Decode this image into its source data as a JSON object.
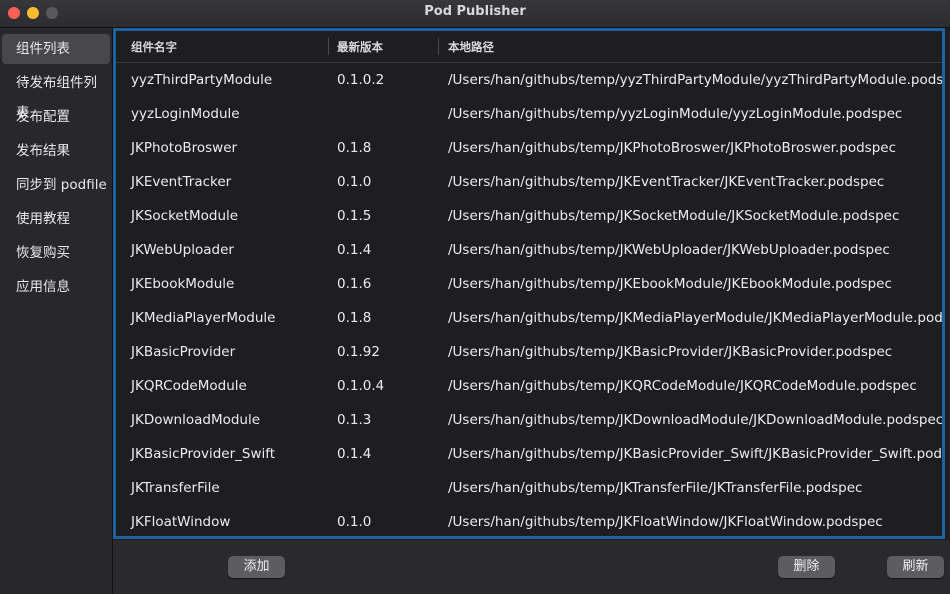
{
  "window": {
    "title": "Pod Publisher"
  },
  "sidebar": {
    "items": [
      {
        "label": "组件列表"
      },
      {
        "label": "待发布组件列表"
      },
      {
        "label": "发布配置"
      },
      {
        "label": "发布结果"
      },
      {
        "label": "同步到 podfile"
      },
      {
        "label": "使用教程"
      },
      {
        "label": "恢复购买"
      },
      {
        "label": "应用信息"
      }
    ]
  },
  "table": {
    "headers": {
      "name": "组件名字",
      "version": "最新版本",
      "path": "本地路径"
    },
    "rows": [
      {
        "name": "yyzThirdPartyModule",
        "version": "0.1.0.2",
        "path": "/Users/han/githubs/temp/yyzThirdPartyModule/yyzThirdPartyModule.podspec"
      },
      {
        "name": "yyzLoginModule",
        "version": "",
        "path": "/Users/han/githubs/temp/yyzLoginModule/yyzLoginModule.podspec"
      },
      {
        "name": "JKPhotoBroswer",
        "version": "0.1.8",
        "path": "/Users/han/githubs/temp/JKPhotoBroswer/JKPhotoBroswer.podspec"
      },
      {
        "name": "JKEventTracker",
        "version": "0.1.0",
        "path": "/Users/han/githubs/temp/JKEventTracker/JKEventTracker.podspec"
      },
      {
        "name": "JKSocketModule",
        "version": "0.1.5",
        "path": "/Users/han/githubs/temp/JKSocketModule/JKSocketModule.podspec"
      },
      {
        "name": "JKWebUploader",
        "version": "0.1.4",
        "path": "/Users/han/githubs/temp/JKWebUploader/JKWebUploader.podspec"
      },
      {
        "name": "JKEbookModule",
        "version": "0.1.6",
        "path": "/Users/han/githubs/temp/JKEbookModule/JKEbookModule.podspec"
      },
      {
        "name": "JKMediaPlayerModule",
        "version": "0.1.8",
        "path": "/Users/han/githubs/temp/JKMediaPlayerModule/JKMediaPlayerModule.podspec"
      },
      {
        "name": "JKBasicProvider",
        "version": "0.1.92",
        "path": "/Users/han/githubs/temp/JKBasicProvider/JKBasicProvider.podspec"
      },
      {
        "name": "JKQRCodeModule",
        "version": "0.1.0.4",
        "path": "/Users/han/githubs/temp/JKQRCodeModule/JKQRCodeModule.podspec"
      },
      {
        "name": "JKDownloadModule",
        "version": "0.1.3",
        "path": "/Users/han/githubs/temp/JKDownloadModule/JKDownloadModule.podspec"
      },
      {
        "name": "JKBasicProvider_Swift",
        "version": "0.1.4",
        "path": "/Users/han/githubs/temp/JKBasicProvider_Swift/JKBasicProvider_Swift.podspec"
      },
      {
        "name": "JKTransferFile",
        "version": "",
        "path": "/Users/han/githubs/temp/JKTransferFile/JKTransferFile.podspec"
      },
      {
        "name": "JKFloatWindow",
        "version": "0.1.0",
        "path": "/Users/han/githubs/temp/JKFloatWindow/JKFloatWindow.podspec"
      }
    ]
  },
  "buttons": {
    "add": "添加",
    "delete": "删除",
    "refresh": "刷新"
  },
  "colors": {
    "selection_border": "#1e62a0",
    "button_bg": "#5d5d61",
    "sidebar_active": "#48484c"
  }
}
